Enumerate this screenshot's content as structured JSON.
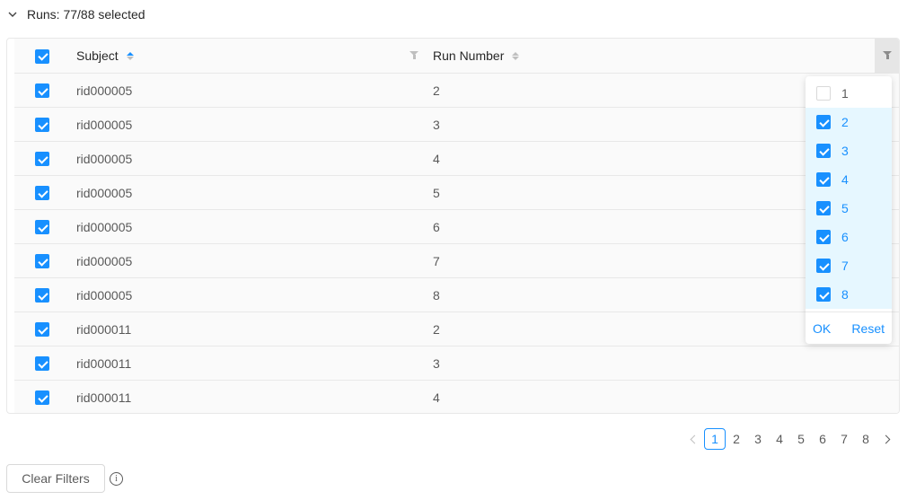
{
  "header": {
    "title": "Runs: 77/88 selected",
    "collapse_icon": "chevron-down-icon"
  },
  "table": {
    "columns": {
      "subject": "Subject",
      "run_number": "Run Number"
    },
    "header_selected": true,
    "subject_sort": "ascending",
    "rows": [
      {
        "subject": "rid000005",
        "run": "2",
        "selected": true
      },
      {
        "subject": "rid000005",
        "run": "3",
        "selected": true
      },
      {
        "subject": "rid000005",
        "run": "4",
        "selected": true
      },
      {
        "subject": "rid000005",
        "run": "5",
        "selected": true
      },
      {
        "subject": "rid000005",
        "run": "6",
        "selected": true
      },
      {
        "subject": "rid000005",
        "run": "7",
        "selected": true
      },
      {
        "subject": "rid000005",
        "run": "8",
        "selected": true
      },
      {
        "subject": "rid000011",
        "run": "2",
        "selected": true
      },
      {
        "subject": "rid000011",
        "run": "3",
        "selected": true
      },
      {
        "subject": "rid000011",
        "run": "4",
        "selected": true
      }
    ]
  },
  "filter_dropdown": {
    "options": [
      {
        "label": "1",
        "checked": false
      },
      {
        "label": "2",
        "checked": true
      },
      {
        "label": "3",
        "checked": true
      },
      {
        "label": "4",
        "checked": true
      },
      {
        "label": "5",
        "checked": true
      },
      {
        "label": "6",
        "checked": true
      },
      {
        "label": "7",
        "checked": true
      },
      {
        "label": "8",
        "checked": true
      }
    ],
    "ok_label": "OK",
    "reset_label": "Reset"
  },
  "pagination": {
    "pages": [
      "1",
      "2",
      "3",
      "4",
      "5",
      "6",
      "7",
      "8"
    ],
    "current": "1"
  },
  "footer": {
    "clear_filters_label": "Clear Filters",
    "info_icon": "info-circle-icon",
    "info_glyph": "i"
  },
  "colors": {
    "accent": "#1890ff",
    "selected_bg": "#e6f7ff"
  }
}
